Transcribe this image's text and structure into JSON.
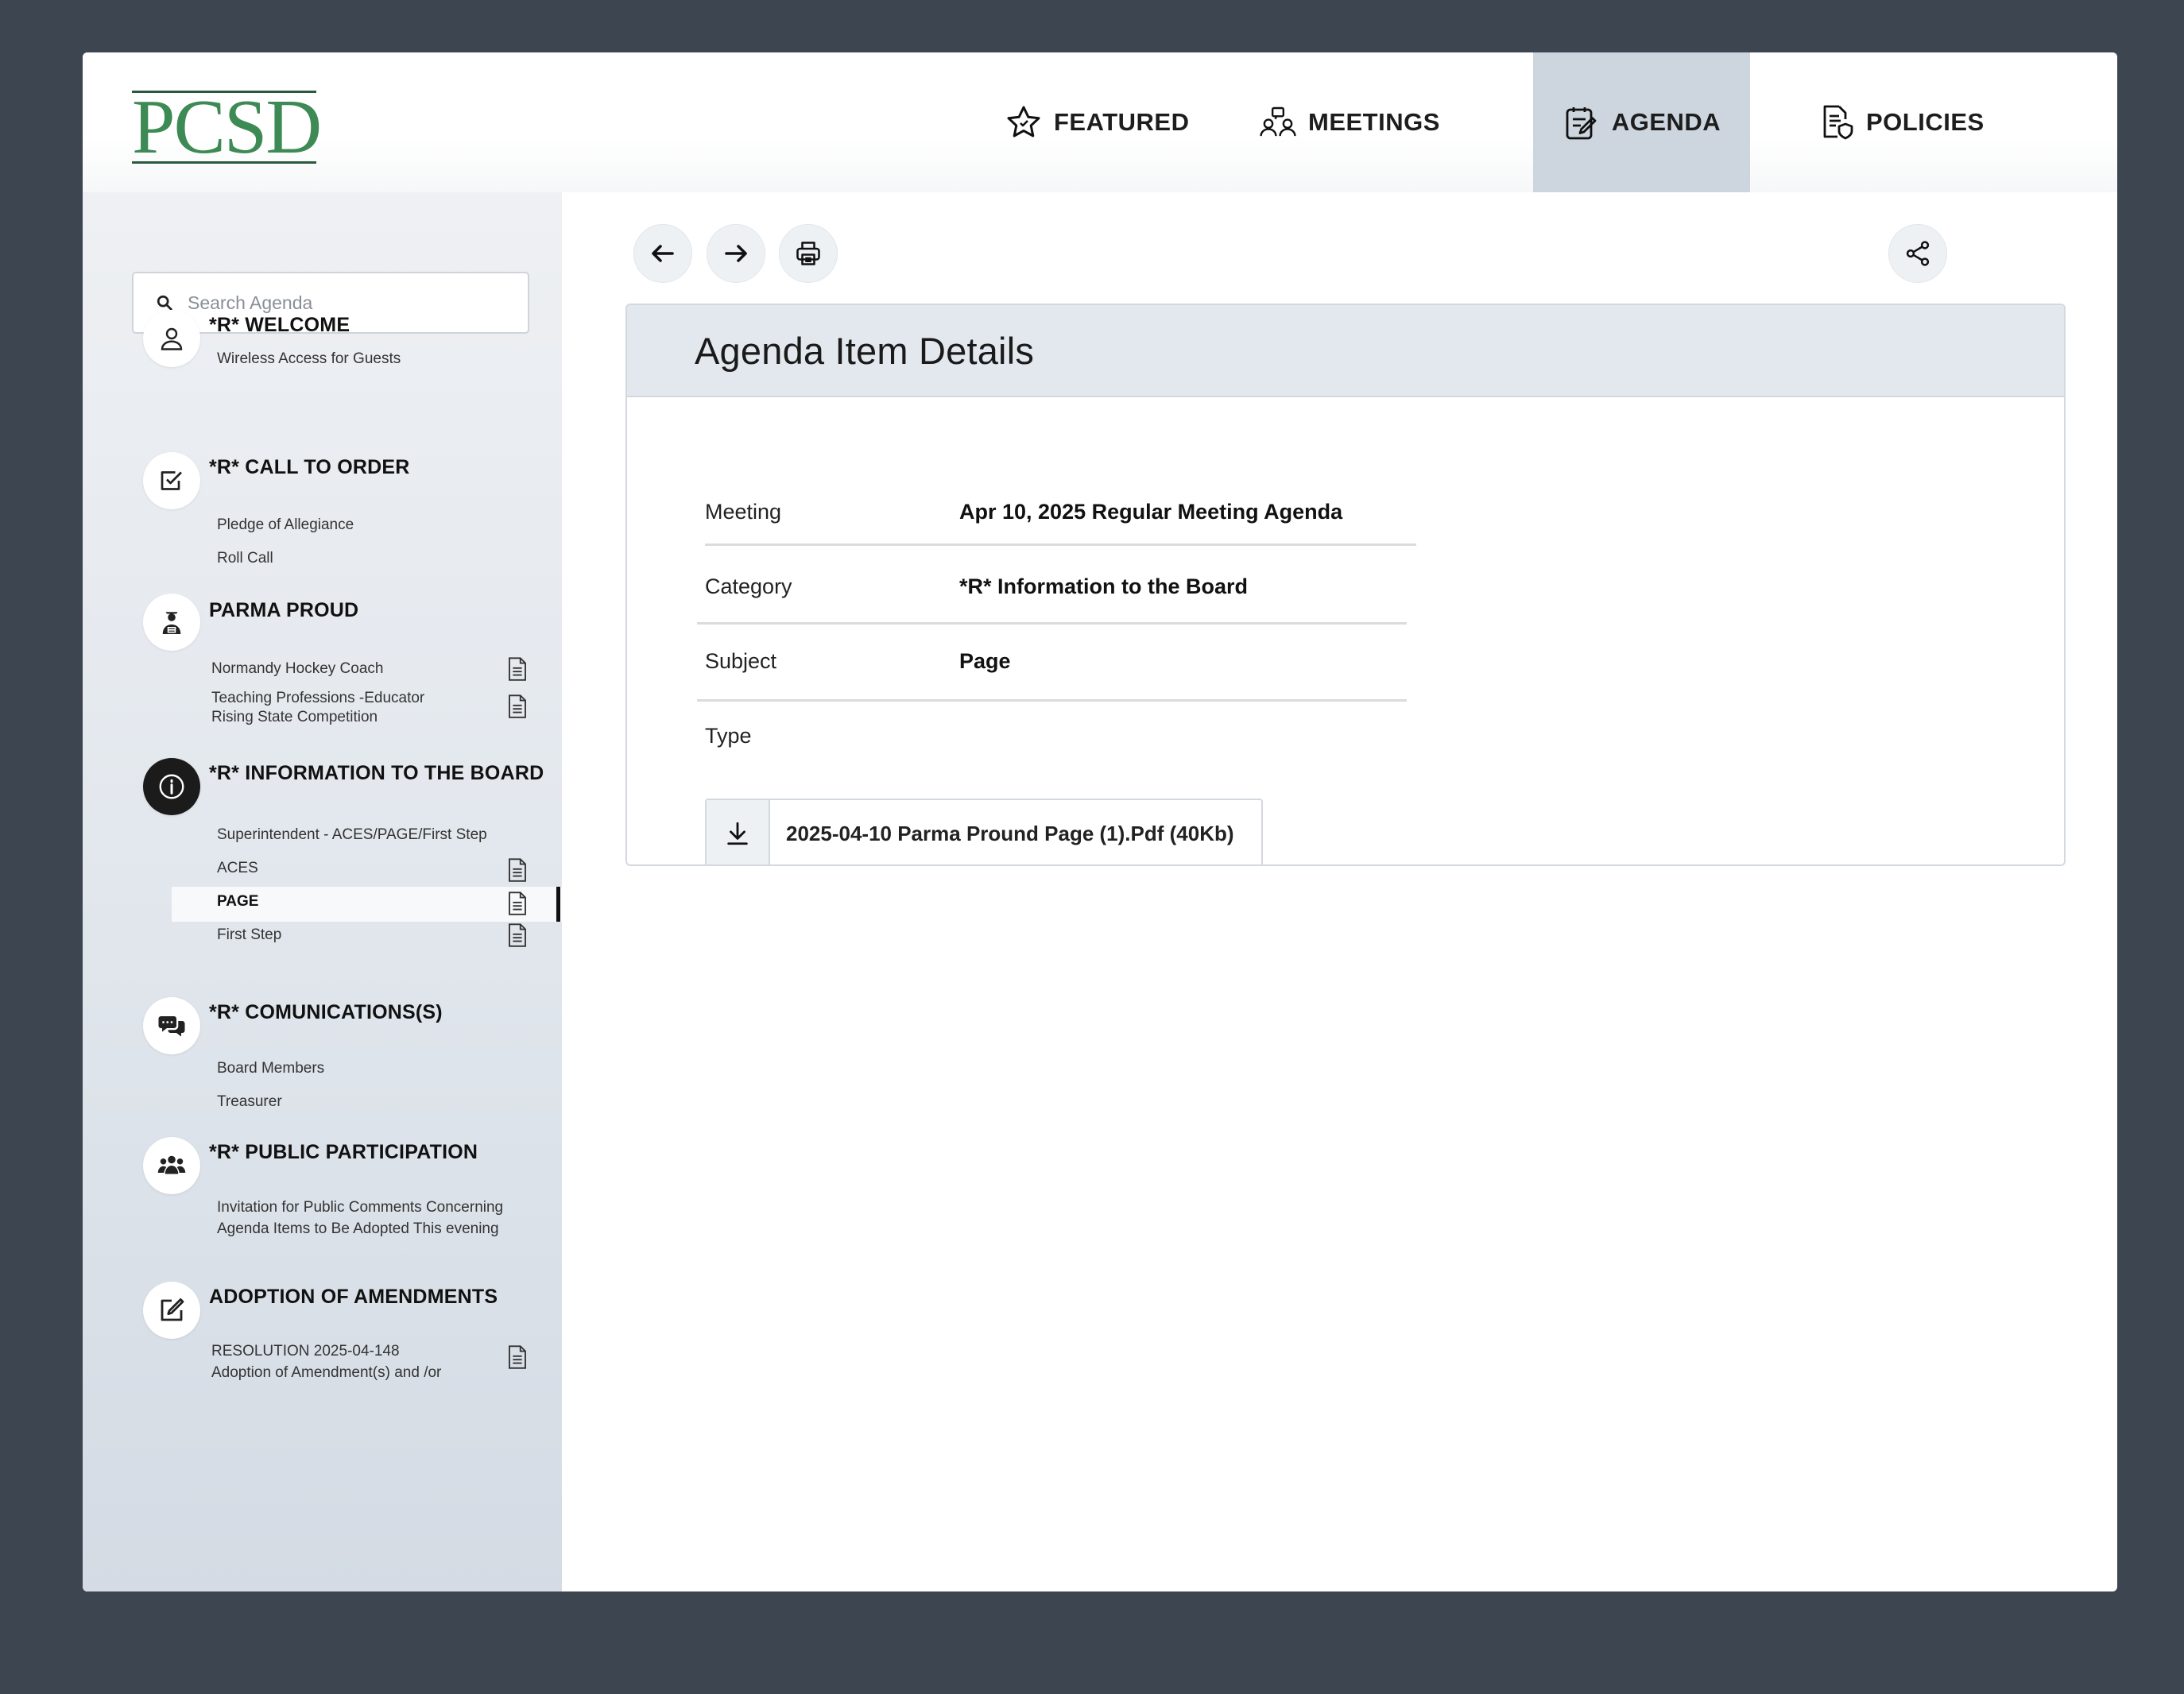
{
  "logo": {
    "text": "PCSD"
  },
  "nav": [
    {
      "label": "FEATURED",
      "icon": "star-icon"
    },
    {
      "label": "MEETINGS",
      "icon": "meeting-people-icon"
    },
    {
      "label": "AGENDA",
      "icon": "agenda-clipboard-icon",
      "active": true
    },
    {
      "label": "POLICIES",
      "icon": "policy-document-icon"
    }
  ],
  "search": {
    "placeholder": "Search Agenda"
  },
  "sections": [
    {
      "title": "*R* WELCOME",
      "icon": "person-icon",
      "items": [
        {
          "label": "Wireless Access for Guests"
        }
      ]
    },
    {
      "title": "*R* CALL TO ORDER",
      "icon": "checkbox-icon",
      "items": [
        {
          "label": "Pledge of Allegiance"
        },
        {
          "label": "Roll Call"
        }
      ]
    },
    {
      "title": "PARMA PROUD",
      "icon": "graduate-icon",
      "items": [
        {
          "label": "Normandy Hockey Coach",
          "doc": true
        },
        {
          "label_line1": "Teaching Professions -Educator",
          "label_line2": "Rising State Competition",
          "doc": true
        }
      ]
    },
    {
      "title": "*R* INFORMATION TO THE BOARD",
      "icon": "info-icon",
      "items": [
        {
          "label": "Superintendent - ACES/PAGE/First Step"
        },
        {
          "label": "ACES",
          "doc": true
        },
        {
          "label": "PAGE",
          "doc": true,
          "active": true
        },
        {
          "label": "First Step",
          "doc": true
        }
      ]
    },
    {
      "title": "*R* COMUNICATIONS(S)",
      "icon": "chat-bubbles-icon",
      "items": [
        {
          "label": "Board Members"
        },
        {
          "label": "Treasurer"
        }
      ]
    },
    {
      "title": "*R* PUBLIC PARTICIPATION",
      "icon": "group-icon",
      "items": [
        {
          "label_line1": "Invitation for Public Comments Concerning",
          "label_line2": "Agenda Items to Be Adopted This evening"
        }
      ]
    },
    {
      "title": "ADOPTION OF AMENDMENTS",
      "icon": "edit-icon",
      "items": [
        {
          "label_line1": "RESOLUTION 2025-04-148",
          "label_line2": "Adoption of Amendment(s)  and /or",
          "doc": true
        }
      ]
    }
  ],
  "toolbar": {
    "back": "arrow-left-icon",
    "forward": "arrow-right-icon",
    "print": "printer-icon",
    "share": "share-icon"
  },
  "details": {
    "title": "Agenda Item Details",
    "meeting_label": "Meeting",
    "meeting_value": "Apr 10, 2025 Regular Meeting Agenda",
    "category_label": "Category",
    "category_value": "*R* Information to the Board",
    "subject_label": "Subject",
    "subject_value": "Page",
    "type_label": "Type",
    "attachment": "2025-04-10 Parma Pround Page (1).Pdf (40Kb)"
  },
  "colors": {
    "background": "#3c4550",
    "logo_green": "#3d8a55",
    "active_tab": "#cdd6df",
    "card_header": "#e3e8ee"
  }
}
